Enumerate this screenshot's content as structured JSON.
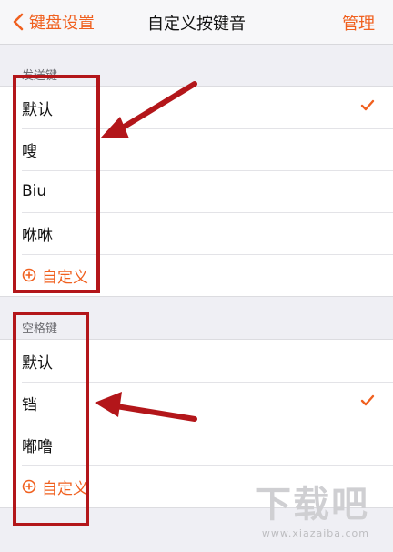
{
  "nav": {
    "back_label": "键盘设置",
    "title": "自定义按键音",
    "manage_label": "管理"
  },
  "send_key": {
    "header": "发送键",
    "options": [
      "默认",
      "嗖",
      "Biu",
      "咻咻"
    ],
    "selected_index": 0,
    "custom_label": "自定义"
  },
  "space_key": {
    "header": "空格键",
    "options": [
      "默认",
      "铛",
      "嘟噜"
    ],
    "selected_index": 1,
    "custom_label": "自定义"
  },
  "colors": {
    "accent": "#f0601f",
    "annotation": "#b3161a"
  },
  "watermark": {
    "logo": "下载吧",
    "url": "www.xiazaiba.com"
  }
}
